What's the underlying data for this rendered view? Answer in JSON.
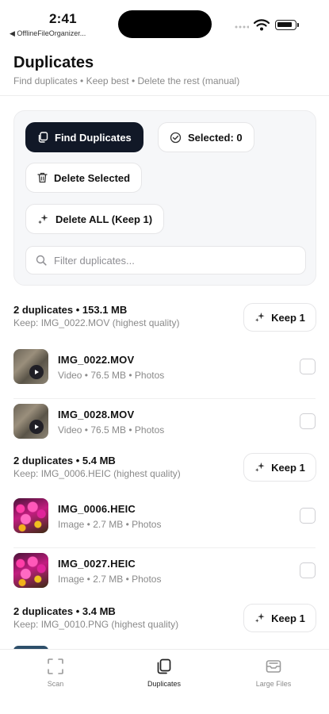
{
  "status_bar": {
    "time": "2:41",
    "back_app": "◀ OfflineFileOrganizer..."
  },
  "header": {
    "title": "Duplicates",
    "subtitle": "Find duplicates • Keep best • Delete the rest (manual)"
  },
  "actions": {
    "find_label": "Find Duplicates",
    "selected_label": "Selected: 0",
    "delete_selected_label": "Delete Selected",
    "delete_all_label": "Delete ALL (Keep 1)",
    "search_placeholder": "Filter duplicates..."
  },
  "groups": [
    {
      "title": "2 duplicates • 153.1 MB",
      "keep": "Keep: IMG_0022.MOV (highest quality)",
      "keep_button": "Keep 1",
      "items": [
        {
          "name": "IMG_0022.MOV",
          "meta": "Video • 76.5 MB • Photos",
          "thumb": "video"
        },
        {
          "name": "IMG_0028.MOV",
          "meta": "Video • 76.5 MB • Photos",
          "thumb": "video"
        }
      ]
    },
    {
      "title": "2 duplicates • 5.4 MB",
      "keep": "Keep: IMG_0006.HEIC (highest quality)",
      "keep_button": "Keep 1",
      "items": [
        {
          "name": "IMG_0006.HEIC",
          "meta": "Image • 2.7 MB • Photos",
          "thumb": "flower"
        },
        {
          "name": "IMG_0027.HEIC",
          "meta": "Image • 2.7 MB • Photos",
          "thumb": "flower"
        }
      ]
    },
    {
      "title": "2 duplicates • 3.4 MB",
      "keep": "Keep: IMG_0010.PNG (highest quality)",
      "keep_button": "Keep 1",
      "items": []
    }
  ],
  "tabs": [
    {
      "label": "Scan",
      "icon": "scan-icon",
      "active": false
    },
    {
      "label": "Duplicates",
      "icon": "duplicates-icon",
      "active": true
    },
    {
      "label": "Large Files",
      "icon": "large-files-icon",
      "active": false
    }
  ],
  "colors": {
    "primary_button": "#111827",
    "muted_text": "#8a8a8a",
    "card_background": "#f6f7f9"
  }
}
